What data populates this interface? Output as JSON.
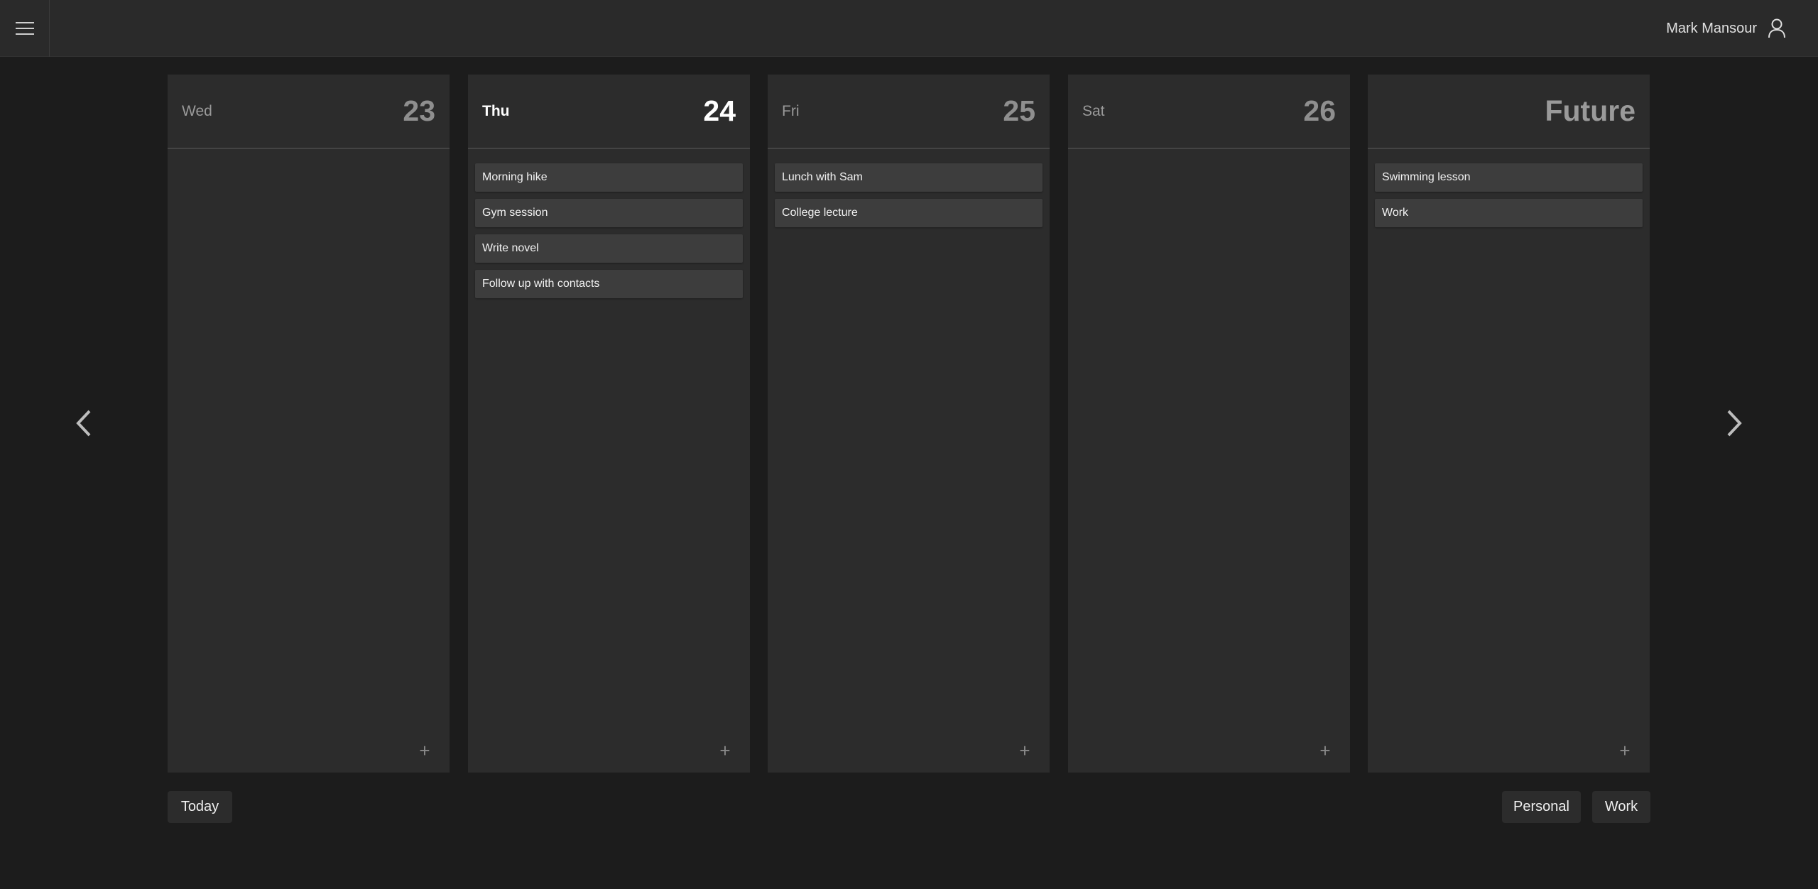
{
  "header": {
    "user_name": "Mark Mansour"
  },
  "columns": [
    {
      "day": "Wed",
      "date": "23",
      "tasks": []
    },
    {
      "day": "Thu",
      "date": "24",
      "tasks": [
        "Morning hike",
        "Gym session",
        "Write novel",
        "Follow up with contacts"
      ]
    },
    {
      "day": "Fri",
      "date": "25",
      "tasks": [
        "Lunch with Sam",
        "College lecture"
      ]
    },
    {
      "day": "Sat",
      "date": "26",
      "tasks": []
    },
    {
      "day": "",
      "date": "Future",
      "tasks": [
        "Swimming lesson",
        "Work"
      ]
    }
  ],
  "add_label": "+",
  "footer": {
    "today_label": "Today",
    "lists": [
      "Personal",
      "Work"
    ]
  },
  "icons": {
    "menu": "hamburger-menu-icon",
    "user": "user-icon",
    "prev": "chevron-left-icon",
    "next": "chevron-right-icon"
  },
  "colors": {
    "background": "#1c1c1c",
    "panel": "#2c2c2c",
    "task": "#3d3d3d",
    "text": "#f2f2f2"
  }
}
